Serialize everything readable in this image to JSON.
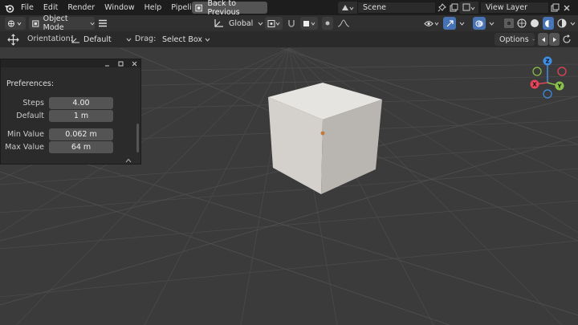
{
  "topbar": {
    "menu": [
      "File",
      "Edit",
      "Render",
      "Window",
      "Help",
      "Pipeline"
    ],
    "back_button": "Back to Previous",
    "scene_name": "Scene",
    "view_layer": "View Layer"
  },
  "header": {
    "mode": "Object Mode",
    "transform_orientation": "Global"
  },
  "tool_settings": {
    "orientation_label": "Orientation:",
    "orientation_value": "Default",
    "drag_label": "Drag:",
    "drag_value": "Select Box",
    "options_label": "Options"
  },
  "preferences": {
    "heading": "Preferences:",
    "rows": [
      {
        "label": "Steps",
        "value": "4.00"
      },
      {
        "label": "Default",
        "value": "1 m"
      },
      {
        "label": "Min Value",
        "value": "0.062 m"
      },
      {
        "label": "Max Value",
        "value": "64 m"
      }
    ]
  },
  "gizmo": {
    "x": "X",
    "y": "Y",
    "z": "Z"
  },
  "colors": {
    "axis_x": "#e8445a",
    "axis_y": "#8bc34a",
    "axis_z": "#3d8fe8",
    "accent": "#4772b3"
  }
}
